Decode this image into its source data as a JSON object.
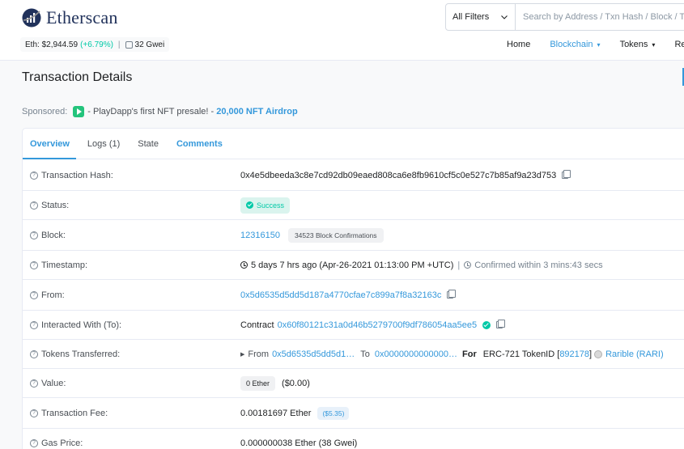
{
  "header": {
    "logo_text": "Etherscan",
    "eth_price_label": "Eth: $2,944.59",
    "eth_change": "(+6.79%)",
    "separator": "|",
    "gas": "32 Gwei",
    "filter_label": "All Filters",
    "search_placeholder": "Search by Address / Txn Hash / Block / To",
    "nav": {
      "home": "Home",
      "blockchain": "Blockchain",
      "tokens": "Tokens",
      "resources": "Re"
    }
  },
  "page": {
    "title": "Transaction Details",
    "sponsored_label": "Sponsored:",
    "sponsored_message": "- PlayDapp's first NFT presale! -",
    "sponsored_link": "20,000 NFT Airdrop"
  },
  "tabs": {
    "overview": "Overview",
    "logs": "Logs (1)",
    "state": "State",
    "comments": "Comments"
  },
  "details": {
    "hash_label": "Transaction Hash:",
    "hash": "0x4e5dbeeda3c8e7cd92db09eaed808ca6e8fb9610cf5c0e527c7b85af9a23d753",
    "status_label": "Status:",
    "status": "Success",
    "block_label": "Block:",
    "block": "12316150",
    "confirmations": "34523 Block Confirmations",
    "timestamp_label": "Timestamp:",
    "timestamp": "5 days 7 hrs ago (Apr-26-2021 01:13:00 PM +UTC)",
    "timestamp_divider": "|",
    "confirmed_within": "Confirmed within 3 mins:43 secs",
    "from_label": "From:",
    "from": "0x5d6535d5dd5d187a4770cfae7c899a7f8a32163c",
    "to_label": "Interacted With (To):",
    "to_prefix": "Contract",
    "to": "0x60f80121c31a0d46b5279700f9df786054aa5ee5",
    "tokens_label": "Tokens Transferred:",
    "tt_from_label": "From",
    "tt_from": "0x5d6535d5dd5d1…",
    "tt_to_label": "To",
    "tt_to": "0x0000000000000…",
    "tt_for_label": "For",
    "tt_standard": "ERC-721 TokenID [",
    "tt_token_id": "892178",
    "tt_bracket_close": "]",
    "tt_token_name": "Rarible (RARI)",
    "value_label": "Value:",
    "value_ether": "0 Ether",
    "value_usd": "($0.00)",
    "fee_label": "Transaction Fee:",
    "fee": "0.00181697 Ether",
    "fee_usd": "($5.35)",
    "gas_price_label": "Gas Price:",
    "gas_price": "0.000000038 Ether (38 Gwei)"
  },
  "colors": {
    "accent": "#3498db",
    "success": "#00c9a7"
  }
}
